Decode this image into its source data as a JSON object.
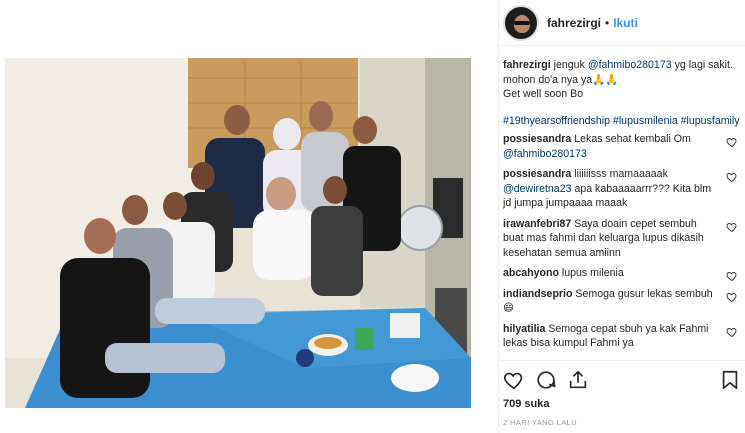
{
  "post": {
    "username": "fahrezirgi",
    "separator": "•",
    "follow_label": "Ikuti"
  },
  "caption": {
    "username": "fahrezirgi",
    "text_before": "jenguk",
    "mention": "@fahmibo280173",
    "text_after": "yg lagi sakit. mohon do'a nya ya🙏🙏",
    "line2": "Get well soon Bo",
    "hashtags": "#19thyearsoffriendship #lupusmilenia #lupusfamily"
  },
  "comments": [
    {
      "username": "possiesandra",
      "text": "Lekas sehat kembali Om",
      "mention": "@fahmibo280173"
    },
    {
      "username": "possiesandra",
      "text": "liiiiiisss mamaaaaak",
      "mention": "@dewiretna23",
      "text2": "apa kabaaaaarrr??? Kita blm jd jumpa jumpaaaa maaak"
    },
    {
      "username": "irawanfebri87",
      "text": "Saya doain cepet sembuh buat mas fahmi dan keluarga lupus dikasih kesehatan semua amiinn"
    },
    {
      "username": "abcahyono",
      "text": "lupus milenia"
    },
    {
      "username": "indiandseprio",
      "text": "Semoga gusur lekas sembuh 😄"
    },
    {
      "username": "hilyatilia",
      "text": "Semoga cepat sbuh ya kak Fahmi lekas bisa kumpul Fahmi ya"
    }
  ],
  "footer": {
    "likes": "709 suka",
    "timestamp": "2 HARI YANG LALU"
  },
  "icons": {
    "like": "heart-icon",
    "comment": "comment-icon",
    "share": "share-icon",
    "save": "bookmark-icon"
  },
  "colors": {
    "link": "#003569",
    "follow": "#3897f0",
    "muted": "#999999"
  }
}
